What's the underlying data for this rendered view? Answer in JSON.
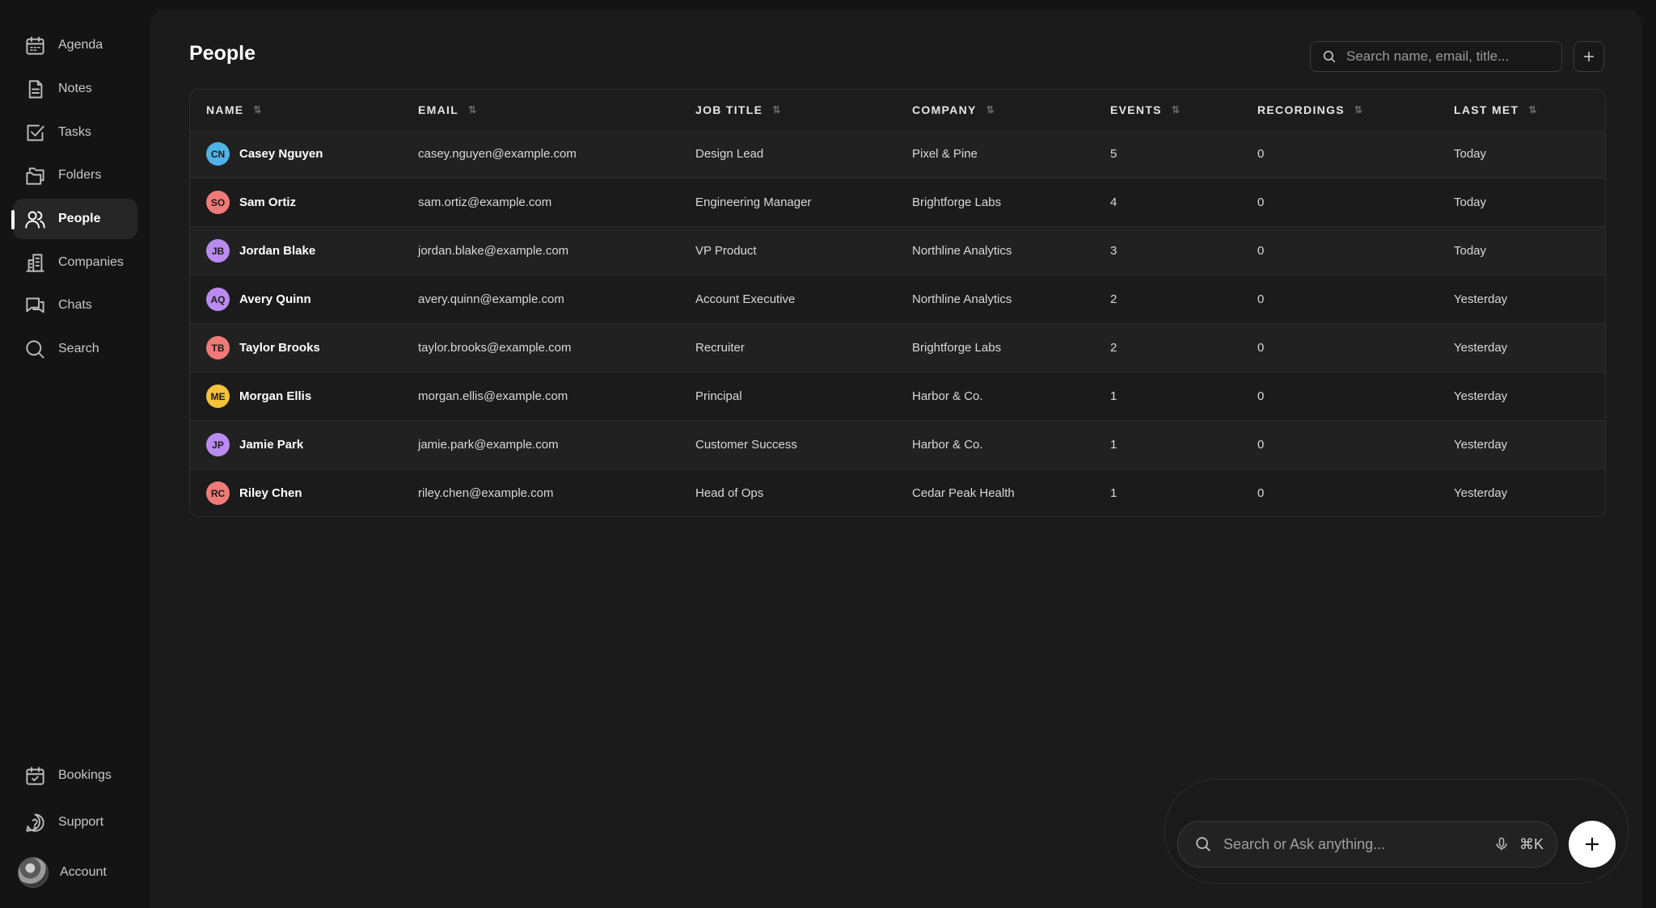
{
  "sidebar": {
    "items": [
      {
        "label": "Agenda",
        "icon": "calendar-icon"
      },
      {
        "label": "Notes",
        "icon": "note-icon"
      },
      {
        "label": "Tasks",
        "icon": "checkbox-icon"
      },
      {
        "label": "Folders",
        "icon": "folder-icon"
      },
      {
        "label": "People",
        "icon": "people-icon",
        "active": true
      },
      {
        "label": "Companies",
        "icon": "building-icon"
      },
      {
        "label": "Chats",
        "icon": "chat-icon"
      },
      {
        "label": "Search",
        "icon": "search-icon"
      }
    ],
    "bottom": [
      {
        "label": "Bookings",
        "icon": "calendar-check-icon"
      },
      {
        "label": "Support",
        "icon": "help-icon"
      },
      {
        "label": "Account",
        "icon": "avatar"
      }
    ]
  },
  "header": {
    "title": "People",
    "search_placeholder": "Search name, email, title..."
  },
  "table": {
    "columns": [
      "NAME",
      "EMAIL",
      "JOB TITLE",
      "COMPANY",
      "EVENTS",
      "RECORDINGS",
      "LAST MET"
    ],
    "rows": [
      {
        "initials": "CN",
        "avatar_color": "#4fb3e8",
        "name": "Casey Nguyen",
        "email": "casey.nguyen@example.com",
        "title": "Design Lead",
        "company": "Pixel & Pine",
        "events": "5",
        "recordings": "0",
        "last_met": "Today"
      },
      {
        "initials": "SO",
        "avatar_color": "#f07a78",
        "name": "Sam Ortiz",
        "email": "sam.ortiz@example.com",
        "title": "Engineering Manager",
        "company": "Brightforge Labs",
        "events": "4",
        "recordings": "0",
        "last_met": "Today"
      },
      {
        "initials": "JB",
        "avatar_color": "#b98bf0",
        "name": "Jordan Blake",
        "email": "jordan.blake@example.com",
        "title": "VP Product",
        "company": "Northline Analytics",
        "events": "3",
        "recordings": "0",
        "last_met": "Today"
      },
      {
        "initials": "AQ",
        "avatar_color": "#b98bf0",
        "name": "Avery Quinn",
        "email": "avery.quinn@example.com",
        "title": "Account Executive",
        "company": "Northline Analytics",
        "events": "2",
        "recordings": "0",
        "last_met": "Yesterday"
      },
      {
        "initials": "TB",
        "avatar_color": "#f07a78",
        "name": "Taylor Brooks",
        "email": "taylor.brooks@example.com",
        "title": "Recruiter",
        "company": "Brightforge Labs",
        "events": "2",
        "recordings": "0",
        "last_met": "Yesterday"
      },
      {
        "initials": "ME",
        "avatar_color": "#f5c23a",
        "name": "Morgan Ellis",
        "email": "morgan.ellis@example.com",
        "title": "Principal",
        "company": "Harbor & Co.",
        "events": "1",
        "recordings": "0",
        "last_met": "Yesterday"
      },
      {
        "initials": "JP",
        "avatar_color": "#b98bf0",
        "name": "Jamie Park",
        "email": "jamie.park@example.com",
        "title": "Customer Success",
        "company": "Harbor & Co.",
        "events": "1",
        "recordings": "0",
        "last_met": "Yesterday"
      },
      {
        "initials": "RC",
        "avatar_color": "#f07a78",
        "name": "Riley Chen",
        "email": "riley.chen@example.com",
        "title": "Head of Ops",
        "company": "Cedar Peak Health",
        "events": "1",
        "recordings": "0",
        "last_met": "Yesterday"
      }
    ]
  },
  "ask_bar": {
    "placeholder": "Search or Ask anything...",
    "shortcut": "⌘K"
  }
}
